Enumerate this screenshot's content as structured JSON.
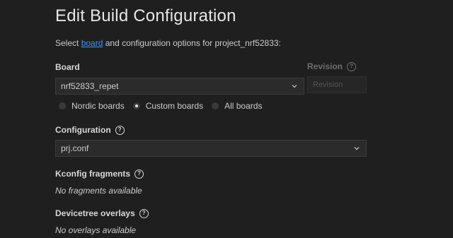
{
  "page": {
    "title": "Edit Build Configuration",
    "subtitle_prefix": "Select ",
    "subtitle_link": "board",
    "subtitle_suffix": " and configuration options for project_nrf52833:"
  },
  "board": {
    "label": "Board",
    "selected": "nrf52833_repet",
    "options": [
      {
        "label": "Nordic boards",
        "checked": false
      },
      {
        "label": "Custom boards",
        "checked": true
      },
      {
        "label": "All boards",
        "checked": false
      }
    ]
  },
  "revision": {
    "label": "Revision",
    "placeholder": "Revision"
  },
  "configuration": {
    "label": "Configuration",
    "selected": "prj.conf"
  },
  "kconfig": {
    "label": "Kconfig fragments",
    "empty": "No fragments available"
  },
  "devicetree": {
    "label": "Devicetree overlays",
    "empty": "No overlays available"
  },
  "icons": {
    "help": "question-circle",
    "chevron": "chevron-down"
  }
}
